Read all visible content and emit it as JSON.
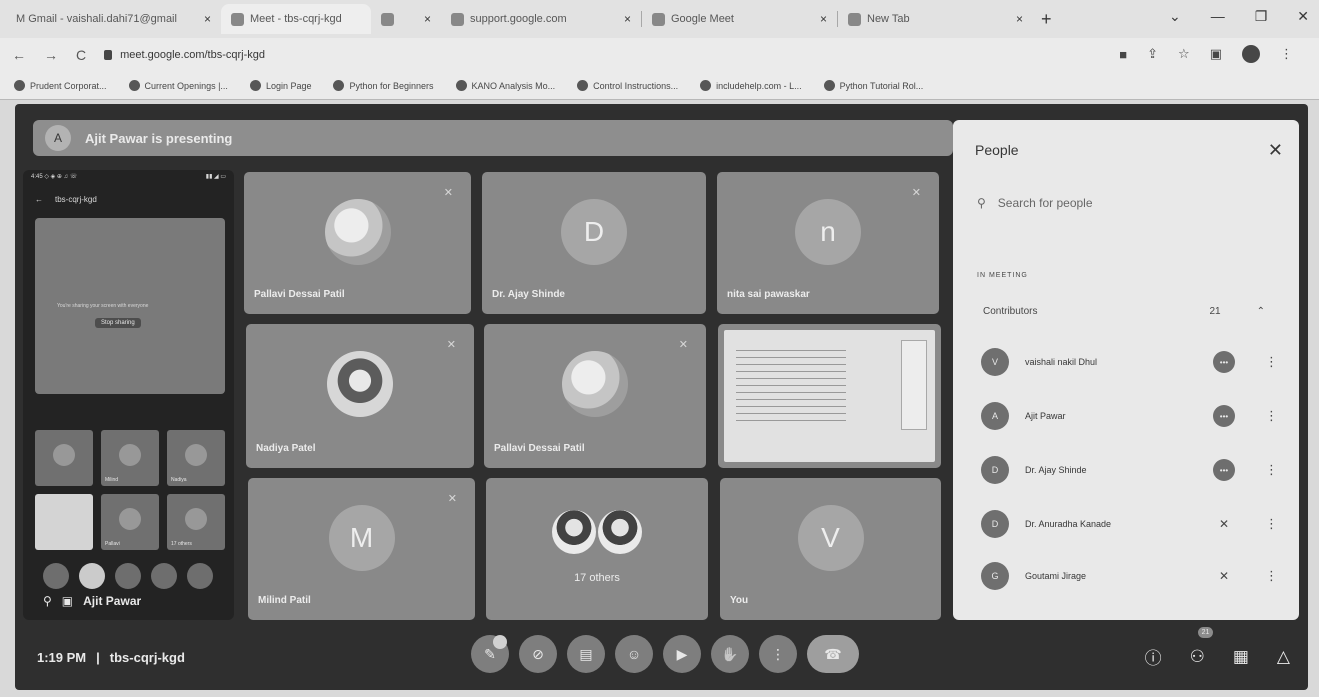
{
  "browser": {
    "tabs": [
      {
        "label": "M  Gmail - vaishali.dahi71@gmail",
        "close": "×"
      },
      {
        "label": "Meet - tbs-cqrj-kgd",
        "close": ""
      },
      {
        "label": "",
        "close": "×"
      },
      {
        "label": "support.google.com",
        "close": "×"
      },
      {
        "label": "Google Meet",
        "close": "×"
      },
      {
        "label": "New Tab",
        "close": "×"
      }
    ],
    "new_tab": "+",
    "url": "meet.google.com/tbs-cqrj-kgd",
    "window_controls": [
      "⌄",
      "—",
      "❐",
      "✕"
    ],
    "bookmarks": [
      "Prudent Corporat...",
      "Current Openings |...",
      "Login Page",
      "Python for Beginners",
      "KANO Analysis Mo...",
      "Control Instructions...",
      "includehelp.com - L...",
      "Python Tutorial Rol..."
    ]
  },
  "meet": {
    "presenting": "Ajit Pawar is presenting",
    "presenter_initial": "A",
    "phone": {
      "status_left": "4:45 ◇ ◈ ⊕ ♫ ☏",
      "status_right": "▮▮ ◢ ▭",
      "meeting_code": "tbs-cqrj-kgd",
      "screen_msg": "You're sharing your screen with everyone",
      "stop_label": "Stop sharing",
      "mini_tiles": [
        "",
        "Milind",
        "Nadiya",
        "",
        "Pallavi",
        "17 others"
      ],
      "presenter_name": "Ajit Pawar"
    },
    "tiles": [
      {
        "name": "Pallavi Dessai Patil",
        "type": "photo"
      },
      {
        "name": "Dr. Ajay Shinde",
        "type": "letter",
        "letter": "D"
      },
      {
        "name": "nita sai pawaskar",
        "type": "letter",
        "letter": "n"
      },
      {
        "name": "Nadiya Patel",
        "type": "photo-dark"
      },
      {
        "name": "Pallavi Dessai Patil",
        "type": "photo"
      },
      {
        "name": "",
        "type": "screen"
      },
      {
        "name": "Milind Patil",
        "type": "letter",
        "letter": "M"
      },
      {
        "name": "17 others",
        "type": "others"
      },
      {
        "name": "You",
        "type": "letter",
        "letter": "V"
      }
    ],
    "time": "1:19 PM",
    "divider": "|",
    "meeting_code": "tbs-cqrj-kgd",
    "participant_count": "21"
  },
  "people_panel": {
    "title": "People",
    "search_placeholder": "Search for people",
    "section": "IN MEETING",
    "group_label": "Contributors",
    "group_count": "21",
    "people": [
      {
        "initial": "V",
        "name": "vaishali nakil Dhul"
      },
      {
        "initial": "A",
        "name": "Ajit Pawar"
      },
      {
        "initial": "D",
        "name": "Dr. Ajay Shinde"
      },
      {
        "initial": "D",
        "name": "Dr. Anuradha Kanade"
      },
      {
        "initial": "G",
        "name": "Goutami Jirage"
      }
    ]
  }
}
